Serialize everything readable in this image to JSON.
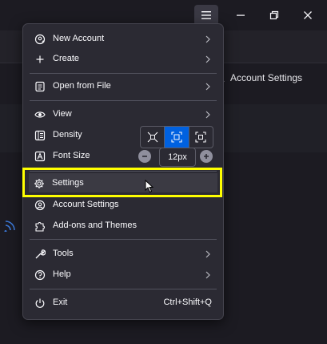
{
  "window": {
    "menu_button_icon": "hamburger-icon",
    "minimize_icon": "minimize-icon",
    "restore_icon": "restore-icon",
    "close_icon": "close-icon"
  },
  "background": {
    "account_settings_label": "Account Settings"
  },
  "menu": {
    "new_account": "New Account",
    "create": "Create",
    "open_from_file": "Open from File",
    "view": "View",
    "density": "Density",
    "density_options": [
      "compact",
      "normal",
      "relaxed"
    ],
    "density_selected": "normal",
    "font_size": "Font Size",
    "font_size_value": "12px",
    "settings": "Settings",
    "account_settings": "Account Settings",
    "addons_and_themes": "Add-ons and Themes",
    "tools": "Tools",
    "help": "Help",
    "exit": "Exit",
    "exit_shortcut": "Ctrl+Shift+Q"
  },
  "colors": {
    "menu_bg": "#2b2a33",
    "accent": "#0061e0",
    "highlight": "#ffff00"
  }
}
